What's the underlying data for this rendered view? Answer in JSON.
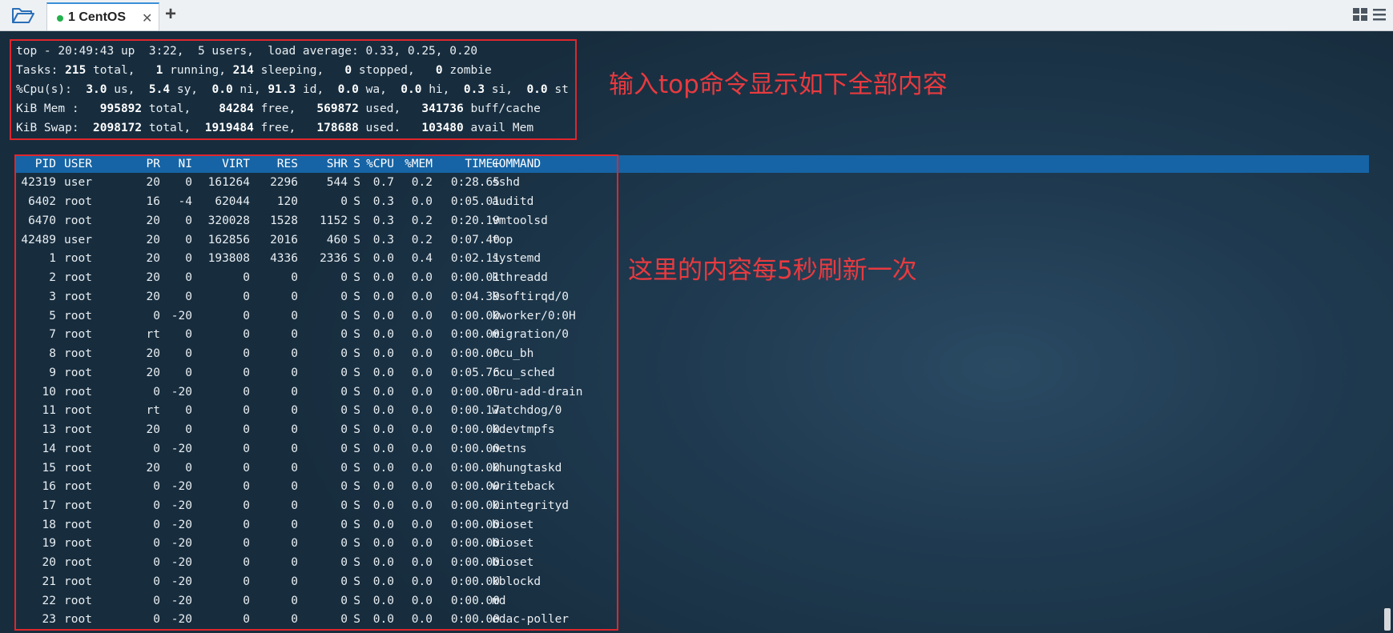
{
  "tabbar": {
    "tab_label": "1 CentOS",
    "tab_status_color": "#22b14c",
    "close_icon": "close-icon",
    "add_icon": "plus-icon",
    "folder_icon": "folder-open-icon",
    "layout_icon": "layout-grid-icon",
    "menu_icon": "menu-icon"
  },
  "summary": {
    "lines": [
      [
        {
          "t": "top - 20:49:43 up  3:22,  5 users,  load average: 0.33, 0.25, 0.20"
        }
      ],
      [
        {
          "t": "Tasks: "
        },
        {
          "t": "215",
          "b": 1
        },
        {
          "t": " total,   "
        },
        {
          "t": "1",
          "b": 1
        },
        {
          "t": " running, "
        },
        {
          "t": "214",
          "b": 1
        },
        {
          "t": " sleeping,   "
        },
        {
          "t": "0",
          "b": 1
        },
        {
          "t": " stopped,   "
        },
        {
          "t": "0",
          "b": 1
        },
        {
          "t": " zombie"
        }
      ],
      [
        {
          "t": "%Cpu(s):  "
        },
        {
          "t": "3.0",
          "b": 1
        },
        {
          "t": " us,  "
        },
        {
          "t": "5.4",
          "b": 1
        },
        {
          "t": " sy,  "
        },
        {
          "t": "0.0",
          "b": 1
        },
        {
          "t": " ni, "
        },
        {
          "t": "91.3",
          "b": 1
        },
        {
          "t": " id,  "
        },
        {
          "t": "0.0",
          "b": 1
        },
        {
          "t": " wa,  "
        },
        {
          "t": "0.0",
          "b": 1
        },
        {
          "t": " hi,  "
        },
        {
          "t": "0.3",
          "b": 1
        },
        {
          "t": " si,  "
        },
        {
          "t": "0.0",
          "b": 1
        },
        {
          "t": " st"
        }
      ],
      [
        {
          "t": "KiB Mem :   "
        },
        {
          "t": "995892",
          "b": 1
        },
        {
          "t": " total,    "
        },
        {
          "t": "84284",
          "b": 1
        },
        {
          "t": " free,   "
        },
        {
          "t": "569872",
          "b": 1
        },
        {
          "t": " used,   "
        },
        {
          "t": "341736",
          "b": 1
        },
        {
          "t": " buff/cache"
        }
      ],
      [
        {
          "t": "KiB Swap:  "
        },
        {
          "t": "2098172",
          "b": 1
        },
        {
          "t": " total,  "
        },
        {
          "t": "1919484",
          "b": 1
        },
        {
          "t": " free,   "
        },
        {
          "t": "178688",
          "b": 1
        },
        {
          "t": " used.   "
        },
        {
          "t": "103480",
          "b": 1
        },
        {
          "t": " avail Mem"
        }
      ]
    ]
  },
  "process_table": {
    "headers": [
      "PID",
      "USER",
      "PR",
      "NI",
      "VIRT",
      "RES",
      "SHR",
      "S",
      "%CPU",
      "%MEM",
      "TIME+",
      "COMMAND"
    ],
    "rows": [
      [
        "42319",
        "user",
        "20",
        "0",
        "161264",
        "2296",
        "544",
        "S",
        "0.7",
        "0.2",
        "0:28.65",
        "sshd"
      ],
      [
        "6402",
        "root",
        "16",
        "-4",
        "62044",
        "120",
        "0",
        "S",
        "0.3",
        "0.0",
        "0:05.01",
        "auditd"
      ],
      [
        "6470",
        "root",
        "20",
        "0",
        "320028",
        "1528",
        "1152",
        "S",
        "0.3",
        "0.2",
        "0:20.19",
        "vmtoolsd"
      ],
      [
        "42489",
        "user",
        "20",
        "0",
        "162856",
        "2016",
        "460",
        "S",
        "0.3",
        "0.2",
        "0:07.40",
        "top"
      ],
      [
        "1",
        "root",
        "20",
        "0",
        "193808",
        "4336",
        "2336",
        "S",
        "0.0",
        "0.4",
        "0:02.11",
        "systemd"
      ],
      [
        "2",
        "root",
        "20",
        "0",
        "0",
        "0",
        "0",
        "S",
        "0.0",
        "0.0",
        "0:00.01",
        "kthreadd"
      ],
      [
        "3",
        "root",
        "20",
        "0",
        "0",
        "0",
        "0",
        "S",
        "0.0",
        "0.0",
        "0:04.39",
        "ksoftirqd/0"
      ],
      [
        "5",
        "root",
        "0",
        "-20",
        "0",
        "0",
        "0",
        "S",
        "0.0",
        "0.0",
        "0:00.00",
        "kworker/0:0H"
      ],
      [
        "7",
        "root",
        "rt",
        "0",
        "0",
        "0",
        "0",
        "S",
        "0.0",
        "0.0",
        "0:00.00",
        "migration/0"
      ],
      [
        "8",
        "root",
        "20",
        "0",
        "0",
        "0",
        "0",
        "S",
        "0.0",
        "0.0",
        "0:00.00",
        "rcu_bh"
      ],
      [
        "9",
        "root",
        "20",
        "0",
        "0",
        "0",
        "0",
        "S",
        "0.0",
        "0.0",
        "0:05.76",
        "rcu_sched"
      ],
      [
        "10",
        "root",
        "0",
        "-20",
        "0",
        "0",
        "0",
        "S",
        "0.0",
        "0.0",
        "0:00.00",
        "lru-add-drain"
      ],
      [
        "11",
        "root",
        "rt",
        "0",
        "0",
        "0",
        "0",
        "S",
        "0.0",
        "0.0",
        "0:00.17",
        "watchdog/0"
      ],
      [
        "13",
        "root",
        "20",
        "0",
        "0",
        "0",
        "0",
        "S",
        "0.0",
        "0.0",
        "0:00.00",
        "kdevtmpfs"
      ],
      [
        "14",
        "root",
        "0",
        "-20",
        "0",
        "0",
        "0",
        "S",
        "0.0",
        "0.0",
        "0:00.00",
        "netns"
      ],
      [
        "15",
        "root",
        "20",
        "0",
        "0",
        "0",
        "0",
        "S",
        "0.0",
        "0.0",
        "0:00.00",
        "khungtaskd"
      ],
      [
        "16",
        "root",
        "0",
        "-20",
        "0",
        "0",
        "0",
        "S",
        "0.0",
        "0.0",
        "0:00.00",
        "writeback"
      ],
      [
        "17",
        "root",
        "0",
        "-20",
        "0",
        "0",
        "0",
        "S",
        "0.0",
        "0.0",
        "0:00.00",
        "kintegrityd"
      ],
      [
        "18",
        "root",
        "0",
        "-20",
        "0",
        "0",
        "0",
        "S",
        "0.0",
        "0.0",
        "0:00.00",
        "bioset"
      ],
      [
        "19",
        "root",
        "0",
        "-20",
        "0",
        "0",
        "0",
        "S",
        "0.0",
        "0.0",
        "0:00.00",
        "bioset"
      ],
      [
        "20",
        "root",
        "0",
        "-20",
        "0",
        "0",
        "0",
        "S",
        "0.0",
        "0.0",
        "0:00.00",
        "bioset"
      ],
      [
        "21",
        "root",
        "0",
        "-20",
        "0",
        "0",
        "0",
        "S",
        "0.0",
        "0.0",
        "0:00.00",
        "kblockd"
      ],
      [
        "22",
        "root",
        "0",
        "-20",
        "0",
        "0",
        "0",
        "S",
        "0.0",
        "0.0",
        "0:00.00",
        "md"
      ],
      [
        "23",
        "root",
        "0",
        "-20",
        "0",
        "0",
        "0",
        "S",
        "0.0",
        "0.0",
        "0:00.00",
        "edac-poller"
      ]
    ]
  },
  "annotations": {
    "summary_note": "输入top命令显示如下全部内容",
    "table_note": "这里的内容每5秒刷新一次"
  },
  "colors": {
    "highlight_border": "#e0262c",
    "annotation_text": "#e83a3f",
    "header_bar": "#1664a5"
  }
}
